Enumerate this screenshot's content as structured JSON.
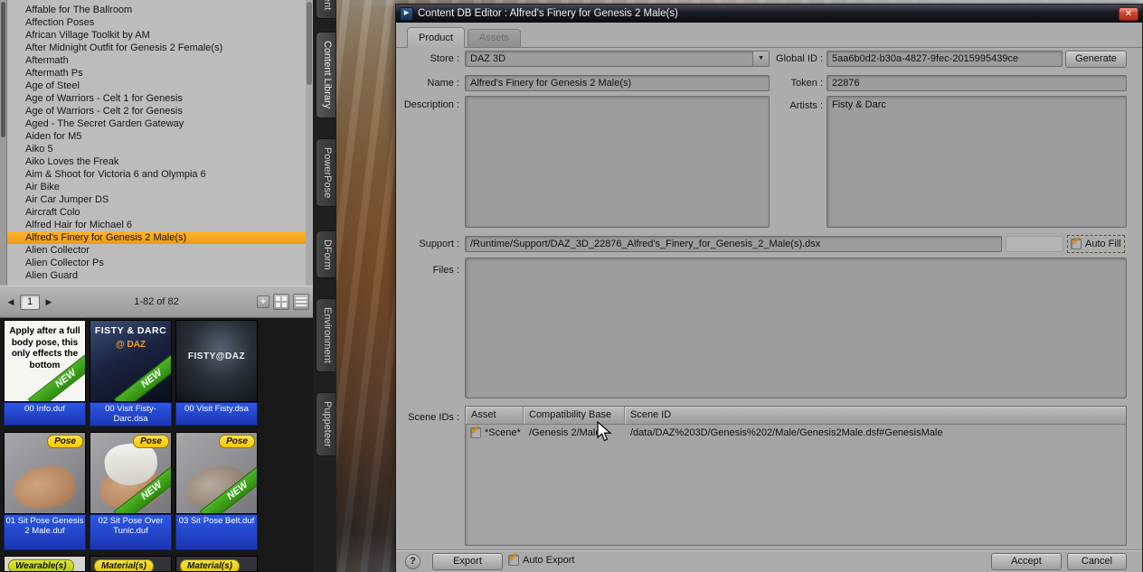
{
  "window": {
    "title": "Content DB Editor : Alfred's Finery for Genesis 2 Male(s)"
  },
  "icons": {
    "prev": "◀",
    "next": "▶",
    "dropdown_arrow": "▼",
    "close": "✕",
    "check": "✔",
    "dialog_glyph": "▶",
    "plus": "+"
  },
  "tabs": {
    "product": "Product",
    "assets": "Assets"
  },
  "form": {
    "store_label": "Store :",
    "store_value": "DAZ 3D",
    "global_id_label": "Global ID :",
    "global_id_value": "5aa6b0d2-b30a-4827-9fec-2015995439ce",
    "generate_label": "Generate",
    "name_label": "Name :",
    "name_value": "Alfred's Finery for Genesis 2 Male(s)",
    "token_label": "Token :",
    "token_value": "22876",
    "description_label": "Description :",
    "description_value": "",
    "artists_label": "Artists :",
    "artists_value": "Fisty & Darc",
    "support_label": "Support :",
    "support_value": "/Runtime/Support/DAZ_3D_22876_Alfred's_Finery_for_Genesis_2_Male(s).dsx",
    "autofill_label": "Auto Fill",
    "files_label": "Files :",
    "scene_ids_label": "Scene IDs :"
  },
  "scene_table": {
    "col_asset": "Asset",
    "col_compat": "Compatibility Base",
    "col_scene_id": "Scene ID",
    "row_asset": "*Scene*",
    "row_compat": "/Genesis 2/Male",
    "row_scene_id": "/data/DAZ%203D/Genesis%202/Male/Genesis2Male.dsf#GenesisMale"
  },
  "footer": {
    "help": "?",
    "export": "Export",
    "auto_export": "Auto Export",
    "accept": "Accept",
    "cancel": "Cancel"
  },
  "library": {
    "items": [
      "Affable for The Ballroom",
      "Affection Poses",
      "African Village Toolkit by AM",
      "After Midnight Outfit for Genesis 2 Female(s)",
      "Aftermath",
      "Aftermath Ps",
      "Age of Steel",
      "Age of Warriors - Celt 1 for Genesis",
      "Age of Warriors - Celt 2 for Genesis",
      "Aged - The Secret Garden Gateway",
      "Aiden for M5",
      "Aiko 5",
      "Aiko Loves the Freak",
      "Aim & Shoot for Victoria 6 and Olympia 6",
      "Air Bike",
      "Air Car Jumper DS",
      "Aircraft Colo",
      "Alfred Hair for Michael 6",
      "Alfred's Finery for Genesis 2 Male(s)",
      "Alien Collector",
      "Alien Collector Ps",
      "Alien Guard"
    ],
    "pagination": {
      "page": "1",
      "range": "1-82 of 82"
    },
    "new_label": "NEW",
    "thumbs": [
      {
        "label": "00 Info.duf",
        "caption": "Apply after a full body pose, this only effects the bottom"
      },
      {
        "label": "00 Visit Fisty-Darc.dsa",
        "caption": "FISTY & DARC",
        "caption2": "@ DAZ"
      },
      {
        "label": "00 Visit Fisty.dsa",
        "caption": "FISTY@DAZ"
      },
      {
        "label": "01 Sit Pose Genesis 2 Male.duf",
        "badge": "Pose"
      },
      {
        "label": "02 Sit Pose Over Tunic.duf",
        "badge": "Pose"
      },
      {
        "label": "03 Sit Pose Belt.duf",
        "badge": "Pose"
      }
    ],
    "partial_badges": [
      "Wearable(s)",
      "Material(s)",
      "Material(s)"
    ]
  },
  "side_tabs": [
    "ent",
    "Content Library",
    "PowerPose",
    "DForm",
    "Environment",
    "Puppeteer"
  ]
}
